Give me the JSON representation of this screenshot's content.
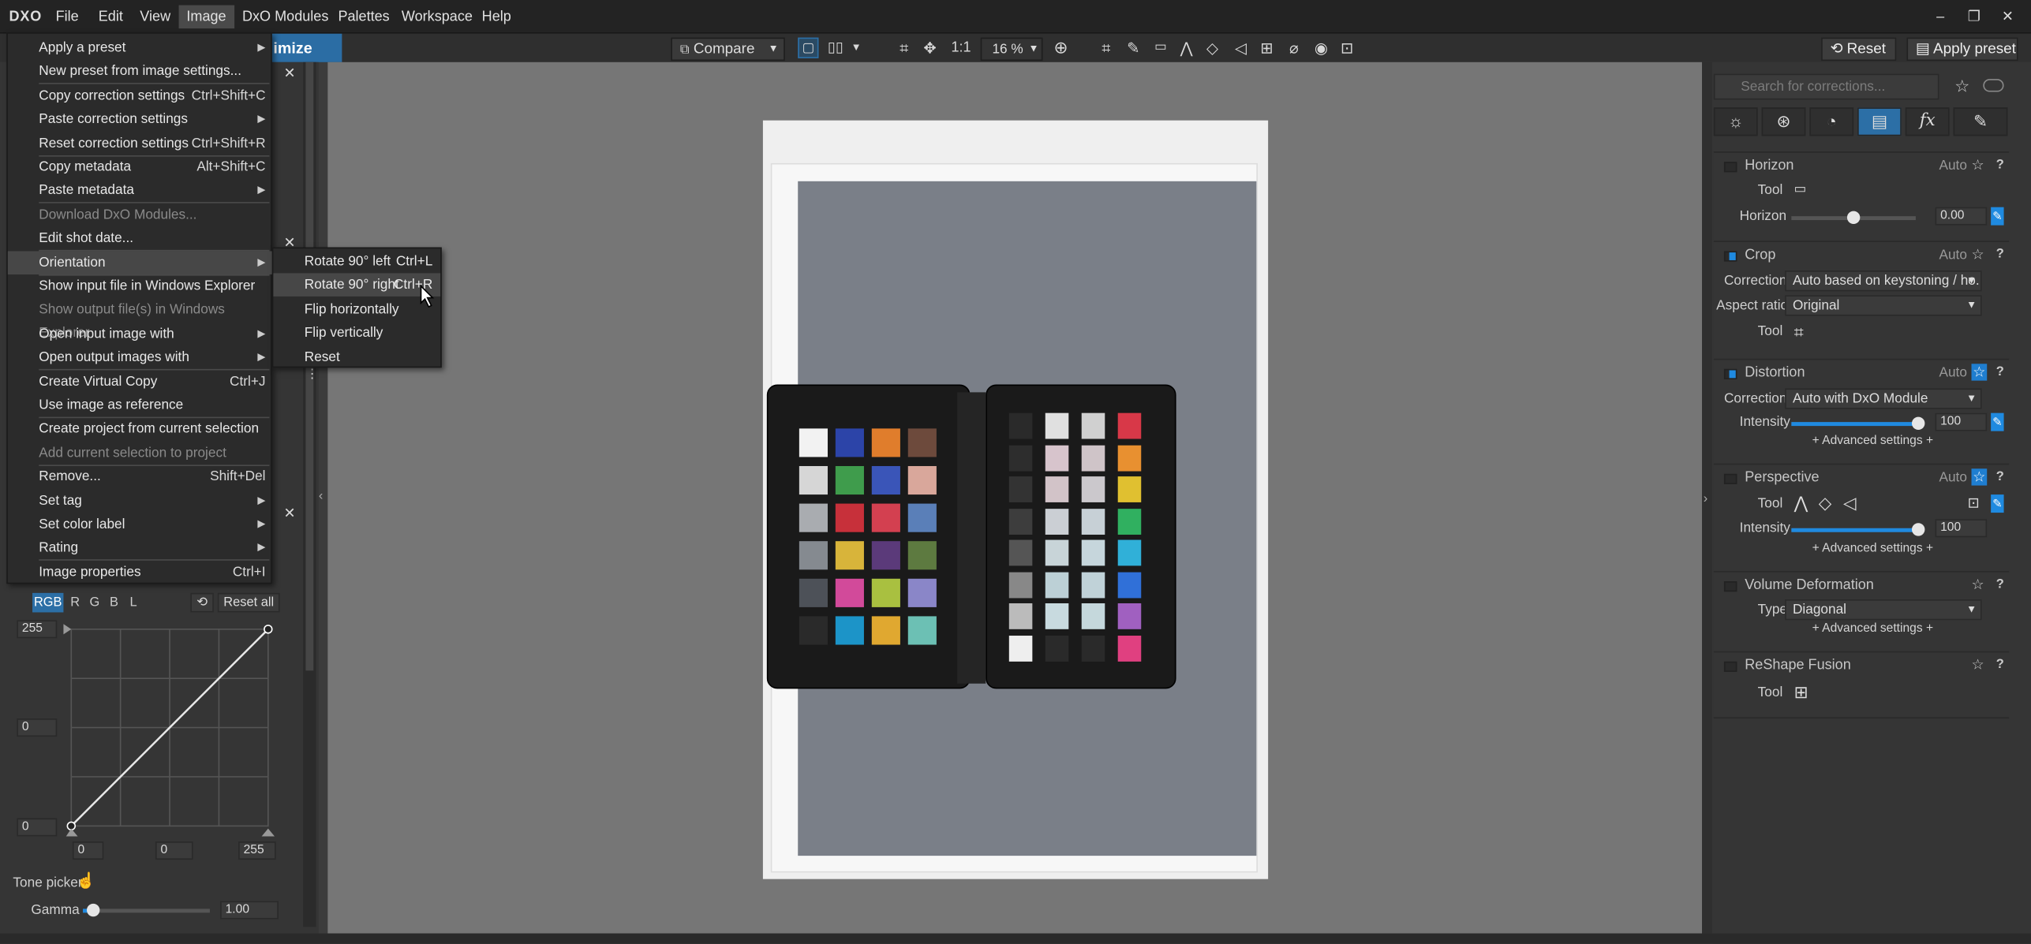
{
  "app": {
    "logo": "DXO"
  },
  "menubar": {
    "items": [
      "File",
      "Edit",
      "View",
      "Image",
      "DxO Modules",
      "Palettes",
      "Workspace",
      "Help"
    ],
    "window_buttons": [
      "–",
      "❐",
      "✕"
    ]
  },
  "toolbar": {
    "compare_label": "Compare",
    "one_to_one": "1:1",
    "zoom": "16 %",
    "reset_label": "Reset",
    "apply_preset_label": "Apply preset",
    "partial_tab": "imize"
  },
  "image_menu": {
    "items": [
      {
        "label": "Apply a preset",
        "shortcut": "",
        "submenu": true,
        "disabled": false
      },
      {
        "label": "New preset from image settings...",
        "shortcut": "",
        "submenu": false,
        "disabled": false
      },
      {
        "label": "Copy correction settings",
        "shortcut": "Ctrl+Shift+C",
        "submenu": false,
        "disabled": false
      },
      {
        "label": "Paste correction settings",
        "shortcut": "",
        "submenu": true,
        "disabled": false
      },
      {
        "label": "Reset correction settings",
        "shortcut": "Ctrl+Shift+R",
        "submenu": false,
        "disabled": false
      },
      {
        "label": "Copy metadata",
        "shortcut": "Alt+Shift+C",
        "submenu": false,
        "disabled": false
      },
      {
        "label": "Paste metadata",
        "shortcut": "",
        "submenu": true,
        "disabled": false
      },
      {
        "label": "Download DxO Modules...",
        "shortcut": "",
        "submenu": false,
        "disabled": true
      },
      {
        "label": "Edit shot date...",
        "shortcut": "",
        "submenu": false,
        "disabled": false
      },
      {
        "label": "Orientation",
        "shortcut": "",
        "submenu": true,
        "disabled": false
      },
      {
        "label": "Show input file in Windows Explorer",
        "shortcut": "",
        "submenu": false,
        "disabled": false
      },
      {
        "label": "Show output file(s) in Windows Explorer",
        "shortcut": "",
        "submenu": false,
        "disabled": true
      },
      {
        "label": "Open input image with",
        "shortcut": "",
        "submenu": true,
        "disabled": false
      },
      {
        "label": "Open output images with",
        "shortcut": "",
        "submenu": true,
        "disabled": false
      },
      {
        "label": "Create Virtual Copy",
        "shortcut": "Ctrl+J",
        "submenu": false,
        "disabled": false
      },
      {
        "label": "Use image as reference",
        "shortcut": "",
        "submenu": false,
        "disabled": false
      },
      {
        "label": "Create project from current selection",
        "shortcut": "",
        "submenu": false,
        "disabled": false
      },
      {
        "label": "Add current selection to project",
        "shortcut": "",
        "submenu": false,
        "disabled": true
      },
      {
        "label": "Remove...",
        "shortcut": "Shift+Del",
        "submenu": false,
        "disabled": false
      },
      {
        "label": "Set tag",
        "shortcut": "",
        "submenu": true,
        "disabled": false
      },
      {
        "label": "Set color label",
        "shortcut": "",
        "submenu": true,
        "disabled": false
      },
      {
        "label": "Rating",
        "shortcut": "",
        "submenu": true,
        "disabled": false
      },
      {
        "label": "Image properties",
        "shortcut": "Ctrl+I",
        "submenu": false,
        "disabled": false
      }
    ]
  },
  "orientation_submenu": {
    "items": [
      {
        "label": "Rotate 90° left",
        "shortcut": "Ctrl+L"
      },
      {
        "label": "Rotate 90° right",
        "shortcut": "Ctrl+R"
      },
      {
        "label": "Flip horizontally",
        "shortcut": ""
      },
      {
        "label": "Flip vertically",
        "shortcut": ""
      },
      {
        "label": "Reset",
        "shortcut": ""
      }
    ]
  },
  "tone_curve": {
    "channels": [
      "RGB",
      "R",
      "G",
      "B",
      "L"
    ],
    "reset_all_label": "Reset all",
    "output_max": "255",
    "output_mid": "0",
    "output_min": "0",
    "input_min": "0",
    "input_mid": "0",
    "input_max": "255",
    "tone_picker_label": "Tone picker",
    "gamma_label": "Gamma",
    "gamma_value": "1.00",
    "gamma_level": 0.08
  },
  "right_panel": {
    "search_placeholder": "Search for corrections...",
    "horizon": {
      "title": "Horizon",
      "auto": "Auto",
      "tool_label": "Tool",
      "slider_label": "Horizon",
      "value": "0.00",
      "level": 0.5
    },
    "crop": {
      "title": "Crop",
      "auto": "Auto",
      "correction_label": "Correction",
      "correction_value": "Auto based on keystoning / ho...",
      "aspect_label": "Aspect ratio",
      "aspect_value": "Original",
      "tool_label": "Tool"
    },
    "distortion": {
      "title": "Distortion",
      "auto": "Auto",
      "correction_label": "Correction",
      "correction_value": "Auto with DxO Module",
      "intensity_label": "Intensity",
      "intensity_value": "100",
      "level": 1.0,
      "advanced": "+ Advanced settings +"
    },
    "perspective": {
      "title": "Perspective",
      "auto": "Auto",
      "tool_label": "Tool",
      "intensity_label": "Intensity",
      "intensity_value": "100",
      "level": 1.0,
      "advanced": "+ Advanced settings +"
    },
    "volume": {
      "title": "Volume Deformation",
      "type_label": "Type",
      "type_value": "Diagonal",
      "advanced": "+ Advanced settings +"
    },
    "reshape": {
      "title": "ReShape Fusion",
      "tool_label": "Tool"
    }
  },
  "colors": {
    "accent": "#1f8ae0",
    "canvas": "#767676",
    "panel": "#353535"
  }
}
